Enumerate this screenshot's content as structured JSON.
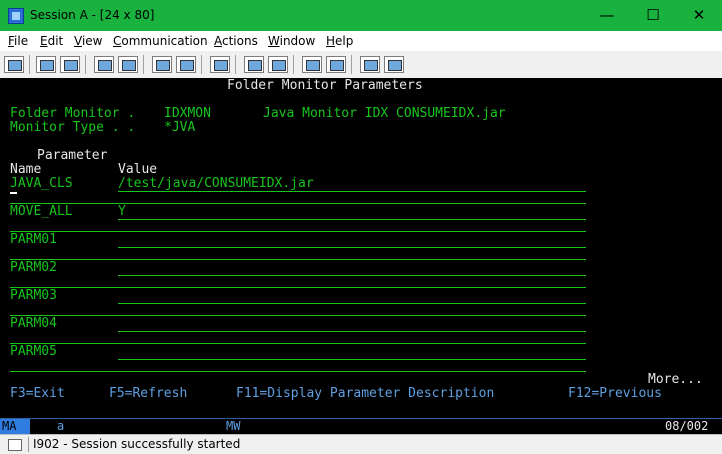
{
  "window": {
    "title": "Session A - [24 x 80]",
    "minimize": "—",
    "maximize": "☐",
    "close": "✕"
  },
  "menu": [
    {
      "accel": "F",
      "rest": "ile"
    },
    {
      "accel": "E",
      "rest": "dit"
    },
    {
      "accel": "V",
      "rest": "iew"
    },
    {
      "accel": "C",
      "rest": "ommunication"
    },
    {
      "accel": "A",
      "rest": "ctions"
    },
    {
      "accel": "W",
      "rest": "indow"
    },
    {
      "accel": "H",
      "rest": "elp"
    }
  ],
  "screen": {
    "title": "Folder Monitor Parameters",
    "folder_monitor_label": "Folder Monitor . ",
    "folder_monitor_value": "IDXMON",
    "folder_monitor_desc": "Java Monitor IDX CONSUMEIDX.jar",
    "monitor_type_label": "Monitor Type . . ",
    "monitor_type_value": "*JVA",
    "col_parameter": "Parameter",
    "col_name": "Name",
    "col_value": "Value",
    "rows": [
      {
        "name": "JAVA_CLS",
        "value": "/test/java/CONSUMEIDX.jar"
      },
      {
        "name": "MOVE_ALL",
        "value": "Y"
      },
      {
        "name": "PARM01",
        "value": ""
      },
      {
        "name": "PARM02",
        "value": ""
      },
      {
        "name": "PARM03",
        "value": ""
      },
      {
        "name": "PARM04",
        "value": ""
      },
      {
        "name": "PARM05",
        "value": ""
      }
    ],
    "more": "More...",
    "fkeys": {
      "f3": "F3=Exit",
      "f5": "F5=Refresh",
      "f11": "F11=Display Parameter Description",
      "f12": "F12=Previous"
    }
  },
  "oia": {
    "ma": "MA",
    "a": "a",
    "mw": "MW",
    "pos": "08/002"
  },
  "status": {
    "message": "I902 - Session successfully started"
  }
}
